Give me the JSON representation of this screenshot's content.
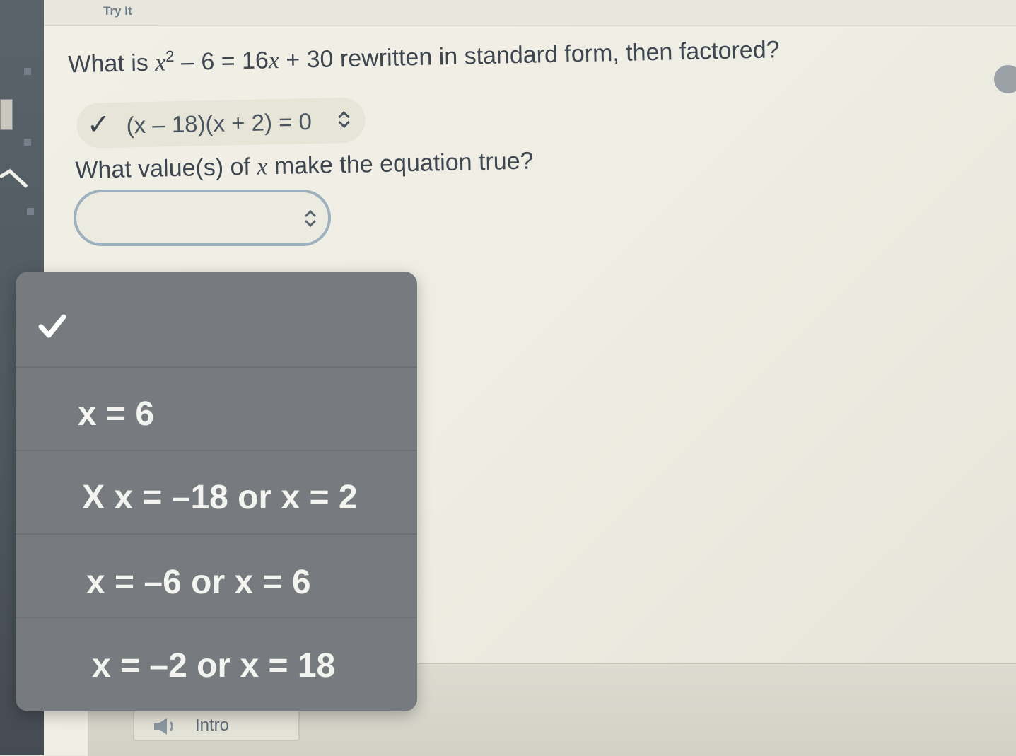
{
  "tabs": {
    "try_it": "Try It"
  },
  "question1": {
    "prefix": "What is ",
    "var": "x",
    "exp": "2",
    "middle": " – 6 = 16",
    "var2": "x",
    "suffix": " + 30 rewritten in standard form, then factored?"
  },
  "answer1": {
    "value": "(x – 18)(x + 2) = 0",
    "status_icon": "check-icon"
  },
  "question2": {
    "prefix": "What value(s) of ",
    "var": "x",
    "suffix": " make the equation true?"
  },
  "answer2": {
    "value": ""
  },
  "dropdown": {
    "options": [
      {
        "label": "",
        "selected": true
      },
      {
        "label": "x = 6"
      },
      {
        "label": "X x = –18 or x = 2"
      },
      {
        "label": "x = –6 or x = 6"
      },
      {
        "label": "x = –2 or x = 18"
      }
    ]
  },
  "footer": {
    "intro_label": "Intro",
    "intro_icon": "speaker-icon"
  },
  "colors": {
    "dropdown_bg": "#777a7e",
    "focus_border": "#9cb0bd",
    "text": "#3e4650"
  }
}
